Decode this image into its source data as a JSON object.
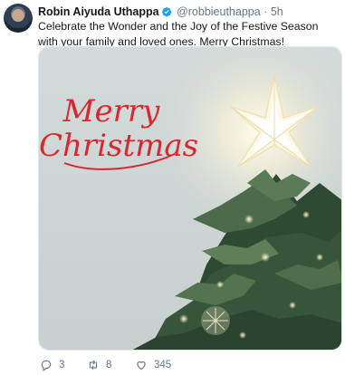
{
  "tweet": {
    "author_name": "Robin Aiyuda Uthappa",
    "handle": "@robbieuthappa",
    "separator": "·",
    "time": "5h",
    "text": "Celebrate the Wonder and the Joy of the Festive Season with your family and loved ones. Merry Christmas!",
    "media": {
      "line1": "Merry",
      "line2": "Christmas",
      "text_color": "#d9262f",
      "background_color": "#cfd7d6"
    },
    "counts": {
      "replies": "3",
      "retweets": "8",
      "likes": "345"
    }
  },
  "colors": {
    "verified": "#1da1f2",
    "muted": "#657786"
  }
}
